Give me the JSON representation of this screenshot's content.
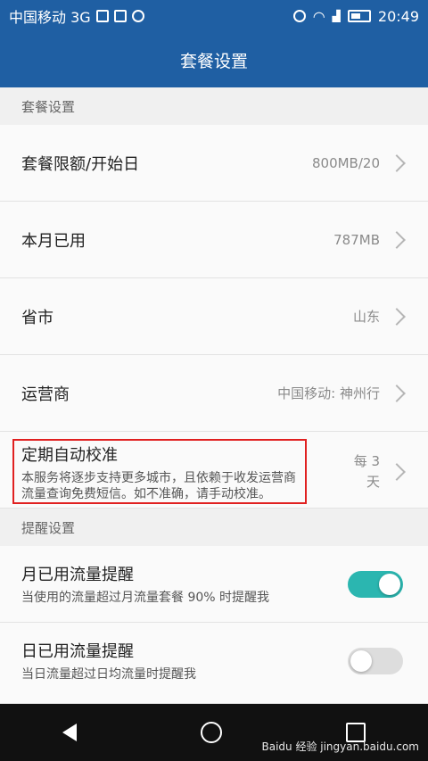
{
  "statusbar": {
    "carrier": "中国移动 3G",
    "time": "20:49"
  },
  "title": "套餐设置",
  "sections": {
    "plan_header": "套餐设置",
    "reminder_header": "提醒设置"
  },
  "rows": {
    "plan_limit": {
      "label": "套餐限额/开始日",
      "value": "800MB/20"
    },
    "used_this_month": {
      "label": "本月已用",
      "value": "787MB"
    },
    "province_city": {
      "label": "省市",
      "value": "山东"
    },
    "operator": {
      "label": "运营商",
      "value": "中国移动: 神州行"
    },
    "auto_calibrate": {
      "label": "定期自动校准",
      "desc": "本服务将逐步支持更多城市，且依赖于收发运营商流量查询免费短信。如不准确，请手动校准。",
      "value_line1": "每 3",
      "value_line2": "天"
    },
    "monthly_reminder": {
      "label": "月已用流量提醒",
      "desc": "当使用的流量超过月流量套餐 90% 时提醒我",
      "on": true
    },
    "daily_reminder": {
      "label": "日已用流量提醒",
      "desc": "当日流量超过日均流量时提醒我",
      "on": false
    }
  },
  "watermark": "Baidu 经验 jingyan.baidu.com"
}
